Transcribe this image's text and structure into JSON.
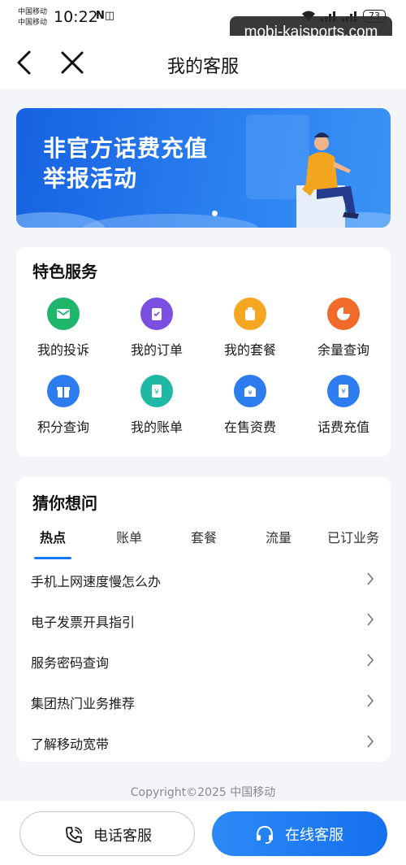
{
  "status_bar": {
    "carrier_1": "中国移动",
    "carrier_2": "中国移动",
    "time": "10:22",
    "battery": "73"
  },
  "watermark": "mobi-kaisports.com",
  "nav": {
    "title": "我的客服"
  },
  "banner": {
    "line1": "非官方话费充值",
    "line2": "举报活动"
  },
  "features": {
    "title": "特色服务",
    "items": [
      {
        "label": "我的投诉",
        "icon": "mail-icon",
        "color": "#1fb56a"
      },
      {
        "label": "我的订单",
        "icon": "order-icon",
        "color": "#7b4fe0"
      },
      {
        "label": "我的套餐",
        "icon": "package-icon",
        "color": "#f5a623"
      },
      {
        "label": "余量查询",
        "icon": "pie-chart-icon",
        "color": "#f06a2a"
      },
      {
        "label": "积分查询",
        "icon": "gift-icon",
        "color": "#2d7cf0"
      },
      {
        "label": "我的账单",
        "icon": "bill-icon",
        "color": "#1fb8a5"
      },
      {
        "label": "在售资费",
        "icon": "tariff-icon",
        "color": "#2d7cf0"
      },
      {
        "label": "话费充值",
        "icon": "recharge-icon",
        "color": "#2d7cf0"
      }
    ]
  },
  "faq": {
    "title": "猜你想问",
    "tabs": [
      "热点",
      "账单",
      "套餐",
      "流量",
      "已订业务"
    ],
    "active_tab": "热点",
    "questions": [
      "手机上网速度慢怎么办",
      "电子发票开具指引",
      "服务密码查询",
      "集团热门业务推荐",
      "了解移动宽带"
    ]
  },
  "footer": {
    "copyright": "Copyright©2025 中国移动"
  },
  "bottom": {
    "phone_label": "电话客服",
    "online_label": "在线客服"
  }
}
